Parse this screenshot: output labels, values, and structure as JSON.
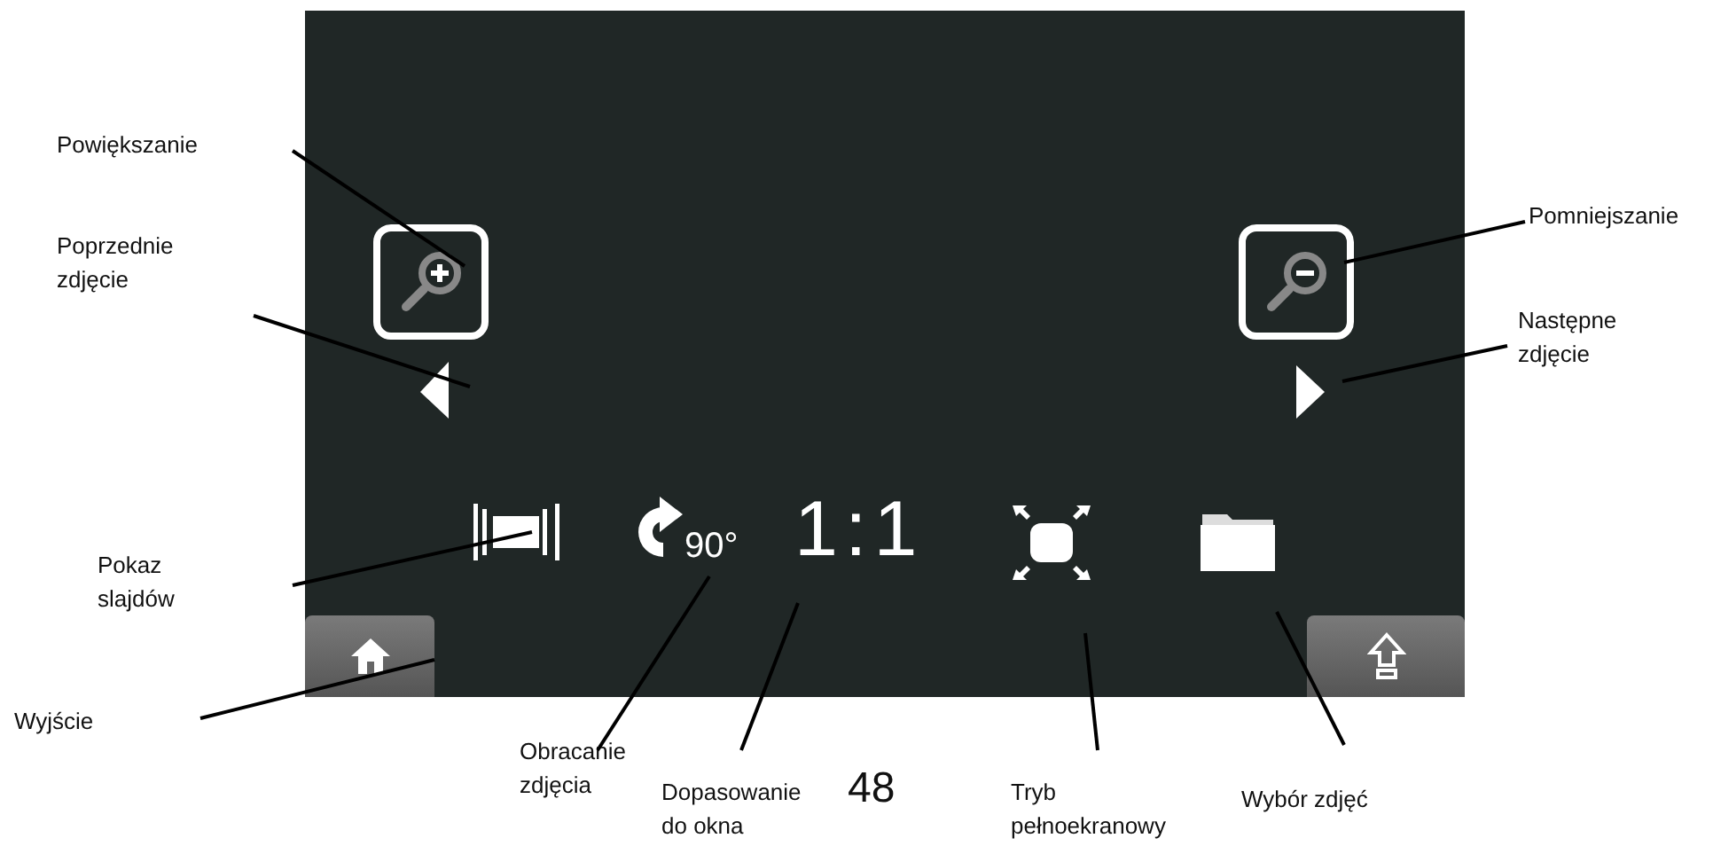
{
  "screen": {
    "controls": [
      {
        "kind": "zoom_in"
      },
      {
        "kind": "zoom_out"
      },
      {
        "kind": "prev"
      },
      {
        "kind": "next"
      },
      {
        "kind": "slideshow"
      },
      {
        "kind": "rotate",
        "text": "90°"
      },
      {
        "kind": "fit",
        "text": "1:1"
      },
      {
        "kind": "fullscreen"
      },
      {
        "kind": "folder"
      },
      {
        "kind": "home"
      },
      {
        "kind": "up"
      }
    ]
  },
  "callouts": [
    {
      "text": "Powiększanie"
    },
    {
      "text": "Poprzednie\nzdjęcie"
    },
    {
      "text": "Pokaz\nslajdów"
    },
    {
      "text": "Wyjście"
    },
    {
      "text": "Obracanie\nzdjęcia"
    },
    {
      "text": "Dopasowanie\ndo okna"
    },
    {
      "text": "Tryb\npełnoekranowy"
    },
    {
      "text": "Wybór zdjęć"
    },
    {
      "text": "Pomniejszanie"
    },
    {
      "text": "Następne\nzdjęcie"
    }
  ],
  "page_number": "48"
}
